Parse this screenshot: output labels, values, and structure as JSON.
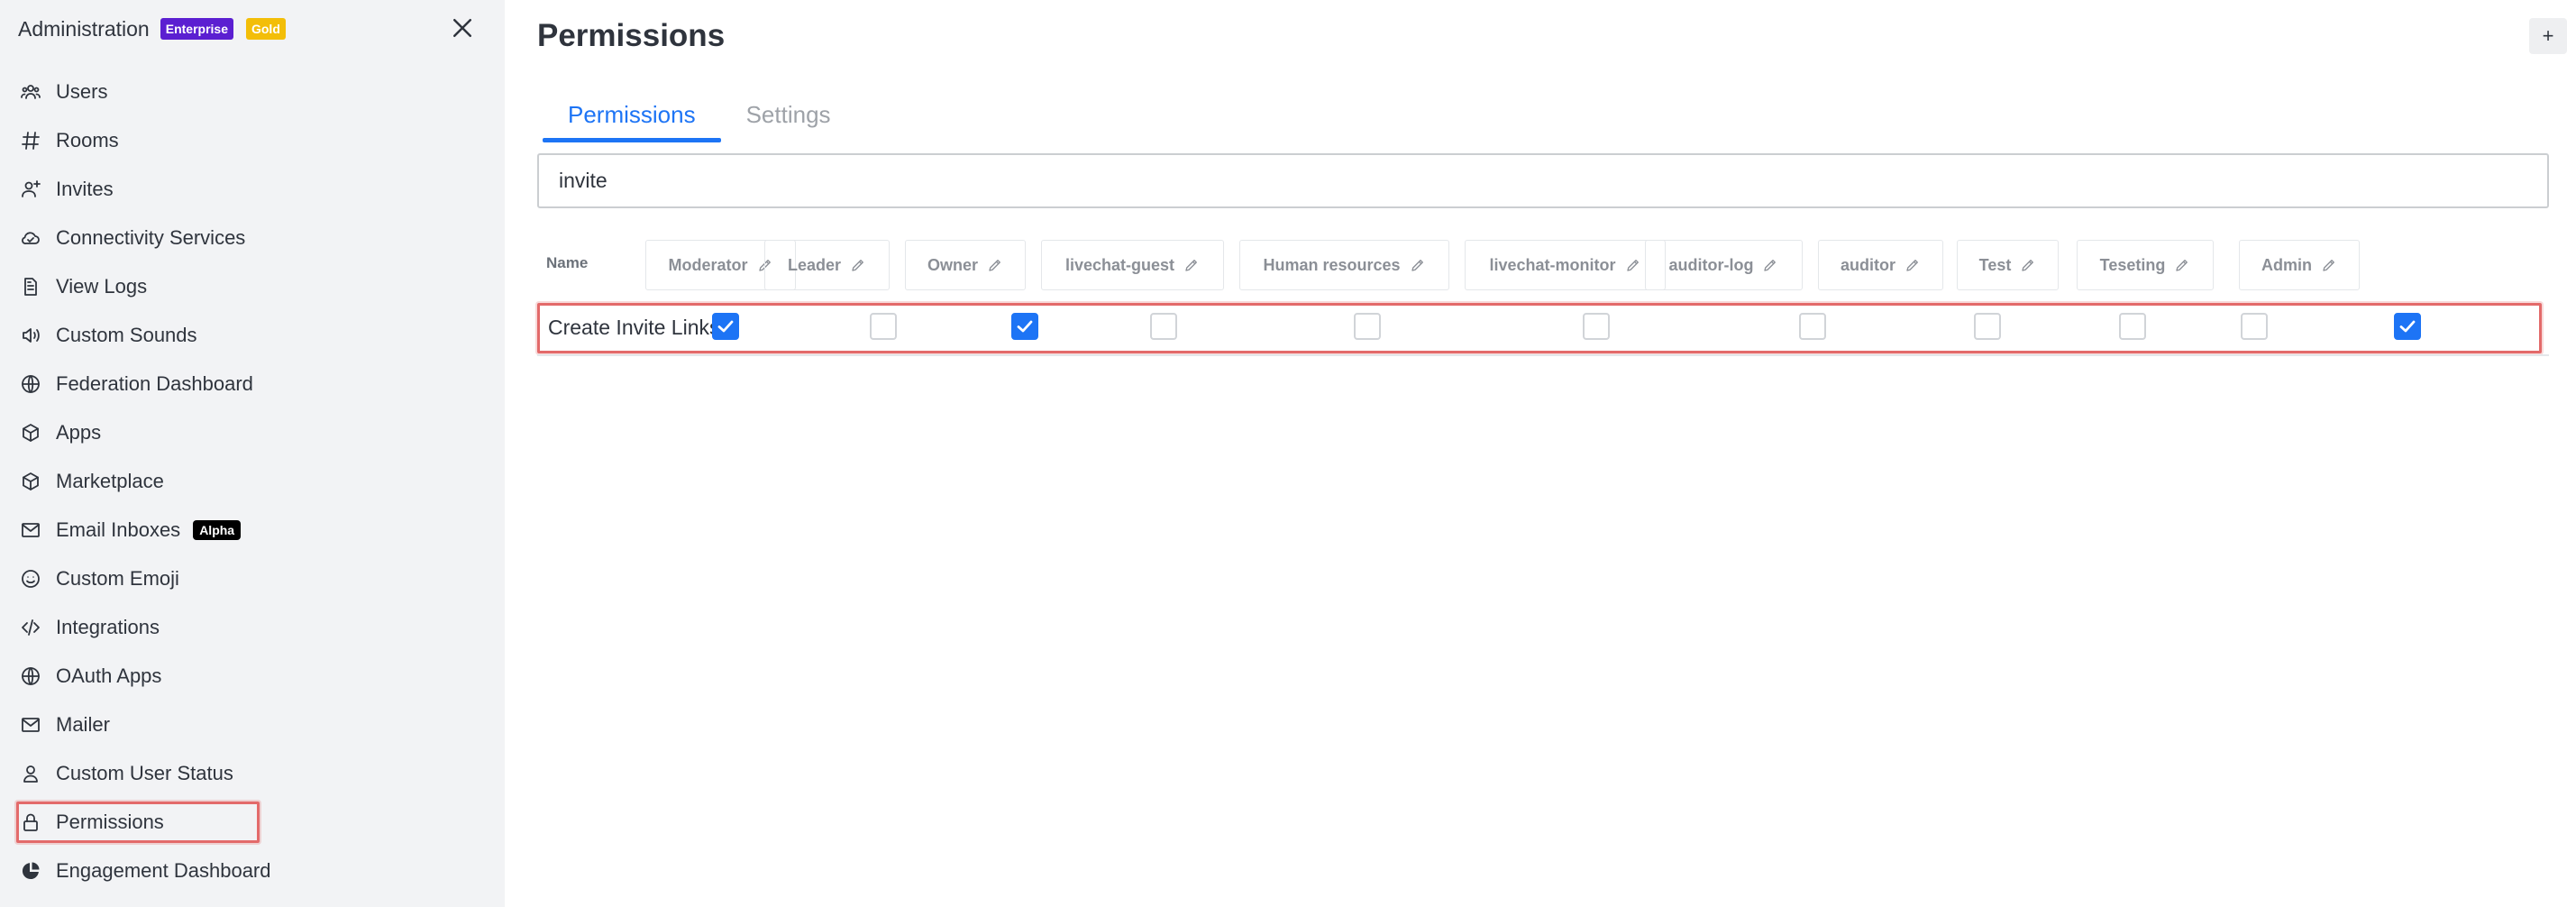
{
  "sidebar": {
    "title": "Administration",
    "badges": {
      "enterprise": "Enterprise",
      "gold": "Gold"
    },
    "items": [
      {
        "label": "Users",
        "icon": "team-icon"
      },
      {
        "label": "Rooms",
        "icon": "hashtag-icon"
      },
      {
        "label": "Invites",
        "icon": "user-plus-icon"
      },
      {
        "label": "Connectivity Services",
        "icon": "cloud-icon"
      },
      {
        "label": "View Logs",
        "icon": "document-icon"
      },
      {
        "label": "Custom Sounds",
        "icon": "sound-icon"
      },
      {
        "label": "Federation Dashboard",
        "icon": "globe-icon"
      },
      {
        "label": "Apps",
        "icon": "cube-icon"
      },
      {
        "label": "Marketplace",
        "icon": "cube-icon"
      },
      {
        "label": "Email Inboxes",
        "icon": "mail-icon",
        "badge": "Alpha"
      },
      {
        "label": "Custom Emoji",
        "icon": "emoji-icon"
      },
      {
        "label": "Integrations",
        "icon": "code-icon"
      },
      {
        "label": "OAuth Apps",
        "icon": "globe-icon"
      },
      {
        "label": "Mailer",
        "icon": "mail-icon"
      },
      {
        "label": "Custom User Status",
        "icon": "user-icon"
      },
      {
        "label": "Permissions",
        "icon": "lock-icon",
        "active": true
      },
      {
        "label": "Engagement Dashboard",
        "icon": "pie-chart-icon"
      }
    ]
  },
  "main": {
    "title": "Permissions",
    "add_button": "+",
    "tabs": [
      {
        "label": "Permissions",
        "active": true
      },
      {
        "label": "Settings",
        "active": false
      }
    ],
    "search": {
      "value": "invite"
    },
    "table": {
      "name_header": "Name",
      "roles": [
        "Moderator",
        "Leader",
        "Owner",
        "livechat-guest",
        "Human resources",
        "livechat-monitor",
        "auditor-log",
        "auditor",
        "Test",
        "Teseting",
        "Admin"
      ],
      "rows": [
        {
          "name": "Create Invite Links",
          "checked": [
            true,
            false,
            true,
            false,
            false,
            false,
            false,
            false,
            false,
            false,
            true
          ]
        }
      ]
    }
  },
  "colors": {
    "accent": "#1d74f5",
    "highlight": "#e36a6a",
    "enterprise": "#5b1fd1",
    "gold": "#f3be08"
  }
}
